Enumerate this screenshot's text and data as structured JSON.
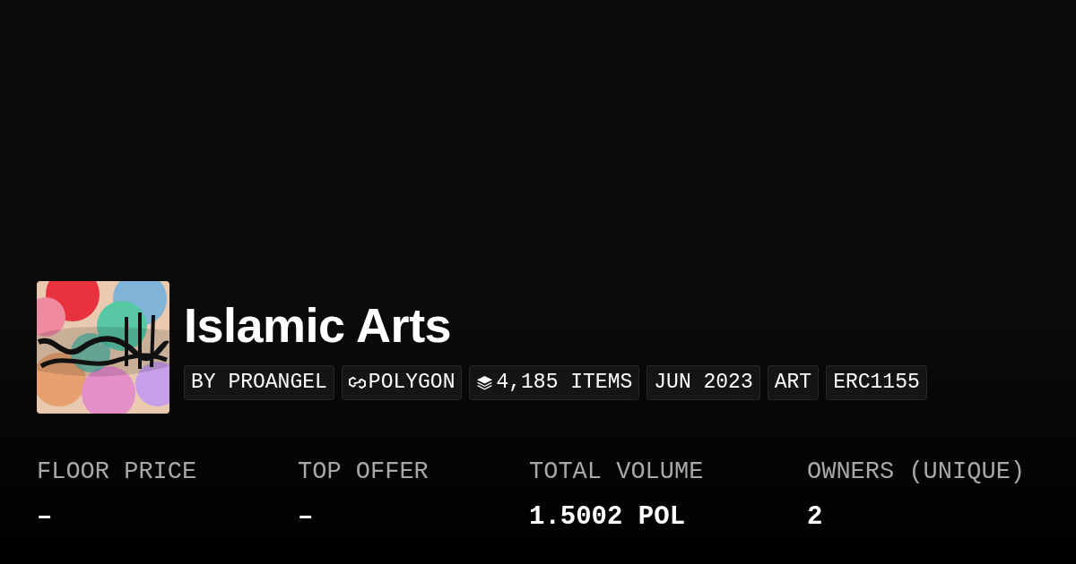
{
  "collection": {
    "title": "Islamic Arts",
    "tags": [
      {
        "kind": "text",
        "label": "BY PROANGEL"
      },
      {
        "kind": "chain",
        "label": "POLYGON"
      },
      {
        "kind": "items",
        "label": "4,185 ITEMS"
      },
      {
        "kind": "text",
        "label": "JUN 2023"
      },
      {
        "kind": "text",
        "label": "ART"
      },
      {
        "kind": "text",
        "label": "ERC1155"
      }
    ]
  },
  "stats": [
    {
      "label": "FLOOR PRICE",
      "value": "–"
    },
    {
      "label": "TOP OFFER",
      "value": "–"
    },
    {
      "label": "TOTAL VOLUME",
      "value": "1.5002 POL"
    },
    {
      "label": "OWNERS (UNIQUE)",
      "value": "2"
    }
  ]
}
